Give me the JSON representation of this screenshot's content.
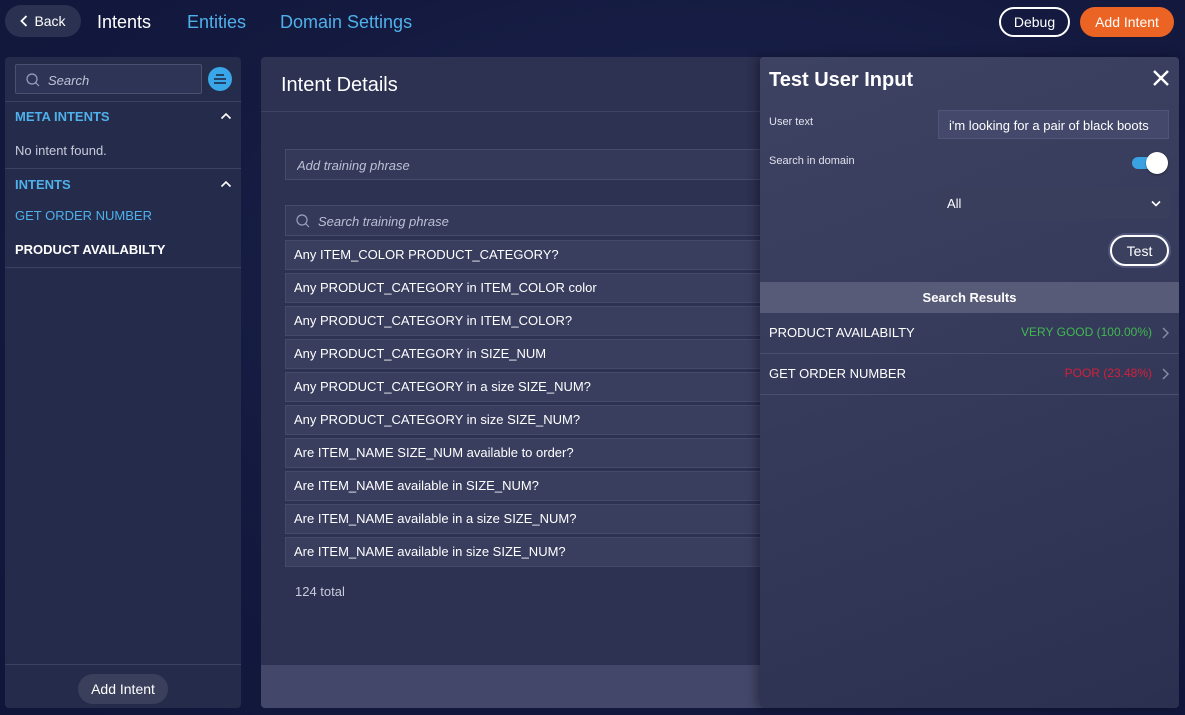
{
  "header": {
    "back_label": "Back",
    "tabs": [
      {
        "label": "Intents",
        "active": true
      },
      {
        "label": "Entities",
        "active": false
      },
      {
        "label": "Domain Settings",
        "active": false
      }
    ],
    "debug_label": "Debug",
    "add_intent_label": "Add Intent"
  },
  "sidebar": {
    "search_placeholder": "Search",
    "meta_section_title": "META INTENTS",
    "meta_empty_text": "No intent found.",
    "intents_section_title": "INTENTS",
    "intents": [
      {
        "label": "GET ORDER NUMBER",
        "selected": true
      },
      {
        "label": "PRODUCT AVAILABILTY",
        "selected": false
      }
    ],
    "add_intent_label": "Add Intent"
  },
  "main": {
    "title": "Intent Details",
    "add_phrase_placeholder": "Add training phrase",
    "search_phrase_placeholder": "Search training phrase",
    "phrases": [
      "Any ITEM_COLOR PRODUCT_CATEGORY?",
      "Any PRODUCT_CATEGORY in ITEM_COLOR color",
      "Any PRODUCT_CATEGORY in ITEM_COLOR?",
      "Any PRODUCT_CATEGORY in SIZE_NUM",
      "Any PRODUCT_CATEGORY in a size SIZE_NUM?",
      "Any PRODUCT_CATEGORY in size SIZE_NUM?",
      "Are ITEM_NAME SIZE_NUM available to order?",
      "Are ITEM_NAME available in SIZE_NUM?",
      "Are ITEM_NAME available in a size SIZE_NUM?",
      "Are ITEM_NAME available in size SIZE_NUM?"
    ],
    "total_text": "124 total"
  },
  "test_panel": {
    "title": "Test User Input",
    "user_text_label": "User text",
    "user_text_value": "i'm looking for a pair of black boots",
    "search_in_domain_label": "Search in domain",
    "search_in_domain_on": true,
    "select_value": "All",
    "test_label": "Test",
    "results_header": "Search Results",
    "results": [
      {
        "name": "PRODUCT AVAILABILTY",
        "score": "VERY GOOD (100.00%)",
        "status": "good"
      },
      {
        "name": "GET ORDER NUMBER",
        "score": "POOR (23.48%)",
        "status": "poor"
      }
    ]
  },
  "colors": {
    "accent_blue": "#4fb0ea",
    "primary_orange": "#ec6424",
    "good_green": "#3fb950",
    "poor_red": "#d1203a"
  },
  "icons": [
    "chevron-left-icon",
    "search-icon",
    "filter-icon",
    "chevron-up-icon",
    "close-icon",
    "chevron-down-icon",
    "chevron-right-icon"
  ]
}
